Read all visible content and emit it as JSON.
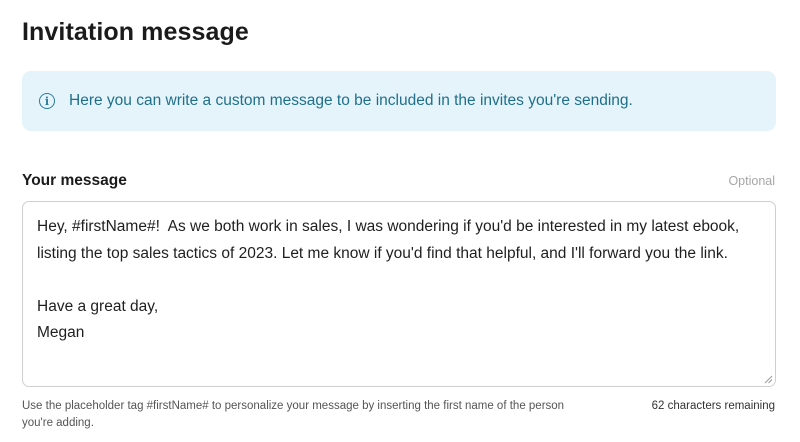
{
  "page": {
    "title": "Invitation message"
  },
  "info_banner": {
    "icon": "info-icon",
    "icon_glyph": "i",
    "text": "Here you can write a custom message to be included in the invites you're sending."
  },
  "message_field": {
    "label": "Your message",
    "optional_label": "Optional",
    "value": "Hey, #firstName#!  As we both work in sales, I was wondering if you'd be interested in my latest ebook, listing the top sales tactics of 2023. Let me know if you'd find that helpful, and I'll forward you the link.\n\nHave a great day,\nMegan",
    "hint": "Use the placeholder tag #firstName# to personalize your message by inserting the first name of the person you're adding.",
    "characters_remaining": "62 characters remaining"
  },
  "colors": {
    "banner_background": "#e5f4fa",
    "banner_text": "#1f6f8b",
    "border": "#cfcfcf"
  }
}
